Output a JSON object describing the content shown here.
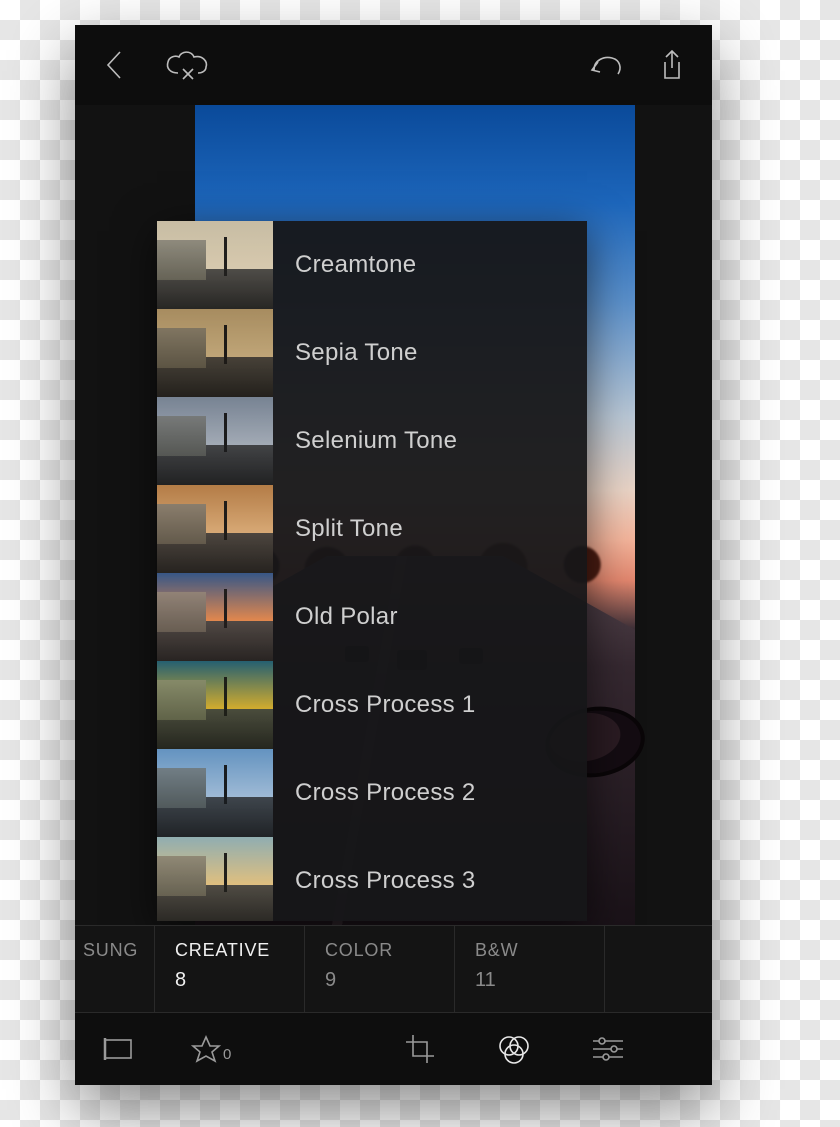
{
  "topbar": {
    "back_icon": "back-chevron-icon",
    "cloud_icon": "cloud-cancel-icon",
    "undo_icon": "undo-icon",
    "share_icon": "share-icon"
  },
  "presets": [
    {
      "label": "Creamtone",
      "sky": "linear-gradient(to bottom,#d8d2c2,#e8e0ce)",
      "tint": "rgba(200,180,140,.35)"
    },
    {
      "label": "Sepia Tone",
      "sky": "linear-gradient(to bottom,#c9b892,#e6d9b6)",
      "tint": "rgba(160,120,60,.45)"
    },
    {
      "label": "Selenium Tone",
      "sky": "linear-gradient(to bottom,#9aa6b4,#d2d8de)",
      "tint": "rgba(90,100,120,.35)"
    },
    {
      "label": "Split Tone",
      "sky": "linear-gradient(to bottom,#c89860,#f0cfa0)",
      "tint": "rgba(180,120,60,.35)"
    },
    {
      "label": "Old Polar",
      "sky": "linear-gradient(to bottom,#3a66a8,#f0a060)",
      "tint": "rgba(200,100,50,.25)"
    },
    {
      "label": "Cross Process 1",
      "sky": "linear-gradient(to bottom,#2a6aa0,#f2c040)",
      "tint": "rgba(160,180,40,.35)"
    },
    {
      "label": "Cross Process 2",
      "sky": "linear-gradient(to bottom,#88b4d6,#d8e4ee)",
      "tint": "rgba(60,120,180,.35)"
    },
    {
      "label": "Cross Process 3",
      "sky": "linear-gradient(to bottom,#9ac4e0,#f0d8a0)",
      "tint": "rgba(200,160,80,.30)"
    }
  ],
  "categories": [
    {
      "name": "SUNG",
      "count": "",
      "active": false,
      "partial": true
    },
    {
      "name": "CREATIVE",
      "count": "8",
      "active": true
    },
    {
      "name": "COLOR",
      "count": "9",
      "active": false
    },
    {
      "name": "B&W",
      "count": "11",
      "active": false
    }
  ],
  "bottombar": {
    "flag_icon": "flag-icon",
    "star_icon": "star-icon",
    "star_count": "0",
    "crop_icon": "crop-icon",
    "presets_icon": "presets-venn-icon",
    "adjust_icon": "sliders-icon"
  }
}
